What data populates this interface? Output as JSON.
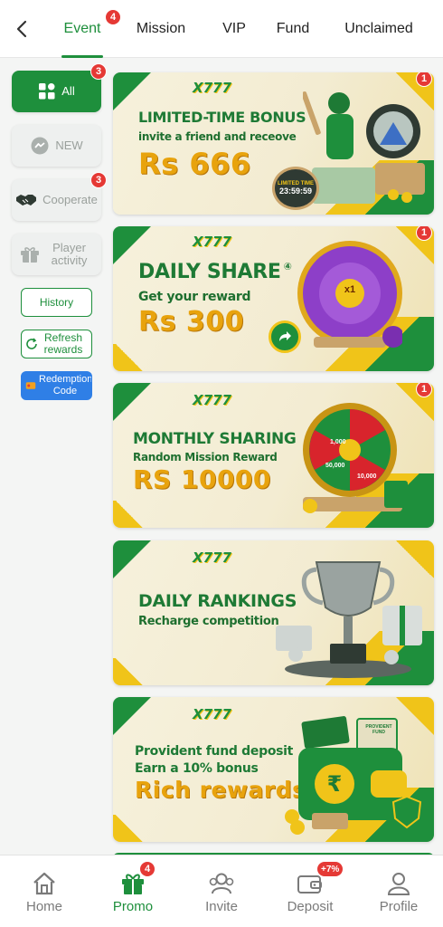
{
  "top_tabs": [
    {
      "label": "Event",
      "badge": "4",
      "active": true
    },
    {
      "label": "Mission"
    },
    {
      "label": "VIP"
    },
    {
      "label": "Fund"
    },
    {
      "label": "Unclaimed"
    }
  ],
  "sidebar": {
    "items": [
      {
        "label": "All",
        "badge": "3",
        "active": true,
        "icon": "grid-icon"
      },
      {
        "label": "NEW",
        "icon": "chat-icon"
      },
      {
        "label": "Cooperate",
        "badge": "3",
        "icon": "handshake-icon"
      },
      {
        "label": "Player activity",
        "icon": "gift-icon"
      }
    ],
    "history_label": "History",
    "refresh_label": "Refresh rewards",
    "redeem_label": "Redemption Code"
  },
  "banners": [
    {
      "logo": "X777",
      "title": "LIMITED-TIME BONUS",
      "subtitle": "invite a friend and receove",
      "amount": "Rs 666",
      "timer_label": "LIMITED TIME",
      "timer": "23:59:59",
      "badge": "1"
    },
    {
      "logo": "X777",
      "title": "DAILY SHARE",
      "title_mark": "④",
      "subtitle": "Get your reward",
      "amount": "Rs 300",
      "wheel_center": "x1",
      "badge": "1"
    },
    {
      "logo": "X777",
      "title": "MONTHLY SHARING",
      "subtitle": "Random Mission Reward",
      "amount": "RS 10000",
      "wheel_labels": [
        "1,000",
        "50,000",
        "10,000"
      ],
      "badge": "1"
    },
    {
      "logo": "X777",
      "title": "DAILY RANKINGS",
      "subtitle": "Recharge competition"
    },
    {
      "logo": "X777",
      "title": "Provident fund deposit",
      "subtitle": "Earn a 10% bonus",
      "amount": "Rich rewards",
      "card_label": "PROVIDENT FUND"
    }
  ],
  "bottom_nav": [
    {
      "label": "Home",
      "icon": "home-icon"
    },
    {
      "label": "Promo",
      "icon": "gift-icon",
      "badge": "4",
      "active": true
    },
    {
      "label": "Invite",
      "icon": "users-icon"
    },
    {
      "label": "Deposit",
      "icon": "wallet-icon",
      "badge": "+7%"
    },
    {
      "label": "Profile",
      "icon": "user-icon"
    }
  ],
  "colors": {
    "accent": "#1e8f3c",
    "gold": "#e8a30d",
    "badge": "#e53935",
    "page_bg": "#f4f5f4"
  }
}
